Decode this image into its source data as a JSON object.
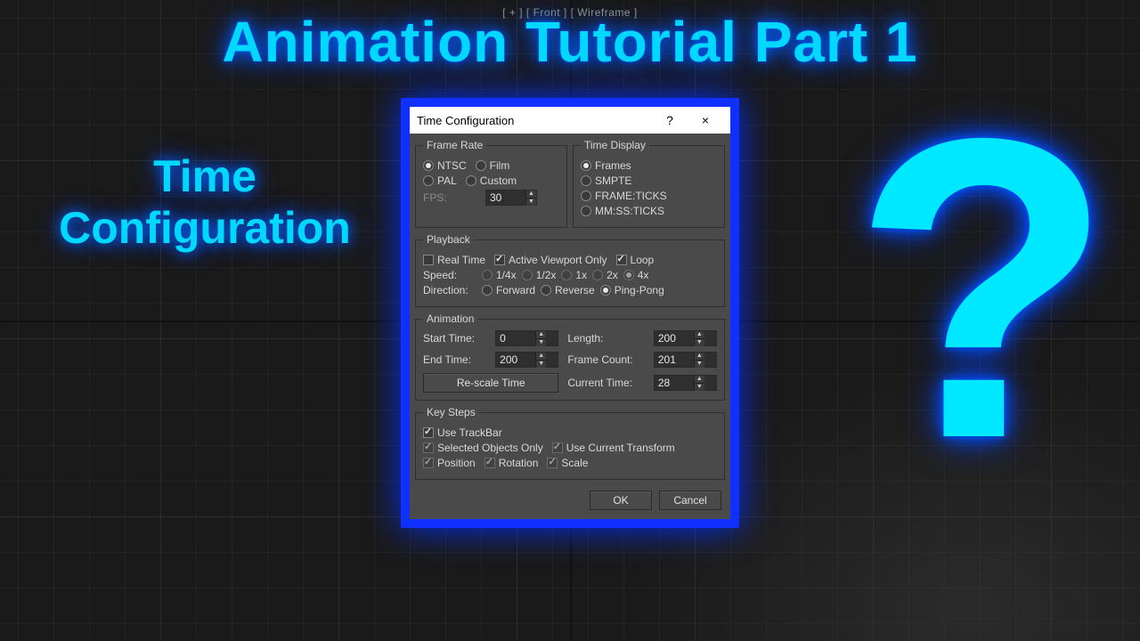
{
  "thumbnail": {
    "title": "Animation Tutorial Part 1",
    "subtitle_line1": "Time",
    "subtitle_line2": "Configuration",
    "question_mark": "?"
  },
  "viewport_label": "[ + ] [ Front ] [ Wireframe ]",
  "dialog": {
    "title": "Time Configuration",
    "help": "?",
    "close": "×",
    "frame_rate": {
      "legend": "Frame Rate",
      "ntsc": "NTSC",
      "film": "Film",
      "pal": "PAL",
      "custom": "Custom",
      "selected": "NTSC",
      "fps_label": "FPS:",
      "fps_value": "30"
    },
    "time_display": {
      "legend": "Time Display",
      "frames": "Frames",
      "smpte": "SMPTE",
      "frame_ticks": "FRAME:TICKS",
      "mm_ss_ticks": "MM:SS:TICKS",
      "selected": "Frames"
    },
    "playback": {
      "legend": "Playback",
      "real_time": "Real Time",
      "active_viewport": "Active Viewport Only",
      "loop": "Loop",
      "real_time_checked": false,
      "active_checked": true,
      "loop_checked": true,
      "speed_label": "Speed:",
      "speeds": [
        "1/4x",
        "1/2x",
        "1x",
        "2x",
        "4x"
      ],
      "speed_selected": "4x",
      "direction_label": "Direction:",
      "directions": [
        "Forward",
        "Reverse",
        "Ping-Pong"
      ],
      "direction_selected": "Ping-Pong"
    },
    "animation": {
      "legend": "Animation",
      "start_label": "Start Time:",
      "start_val": "0",
      "length_label": "Length:",
      "length_val": "200",
      "end_label": "End Time:",
      "end_val": "200",
      "framecount_label": "Frame Count:",
      "framecount_val": "201",
      "rescale_btn": "Re-scale Time",
      "current_label": "Current Time:",
      "current_val": "28"
    },
    "keysteps": {
      "legend": "Key Steps",
      "use_trackbar": "Use TrackBar",
      "selected_only": "Selected Objects Only",
      "use_current_transform": "Use Current Transform",
      "position": "Position",
      "rotation": "Rotation",
      "scale": "Scale"
    },
    "buttons": {
      "ok": "OK",
      "cancel": "Cancel"
    }
  }
}
